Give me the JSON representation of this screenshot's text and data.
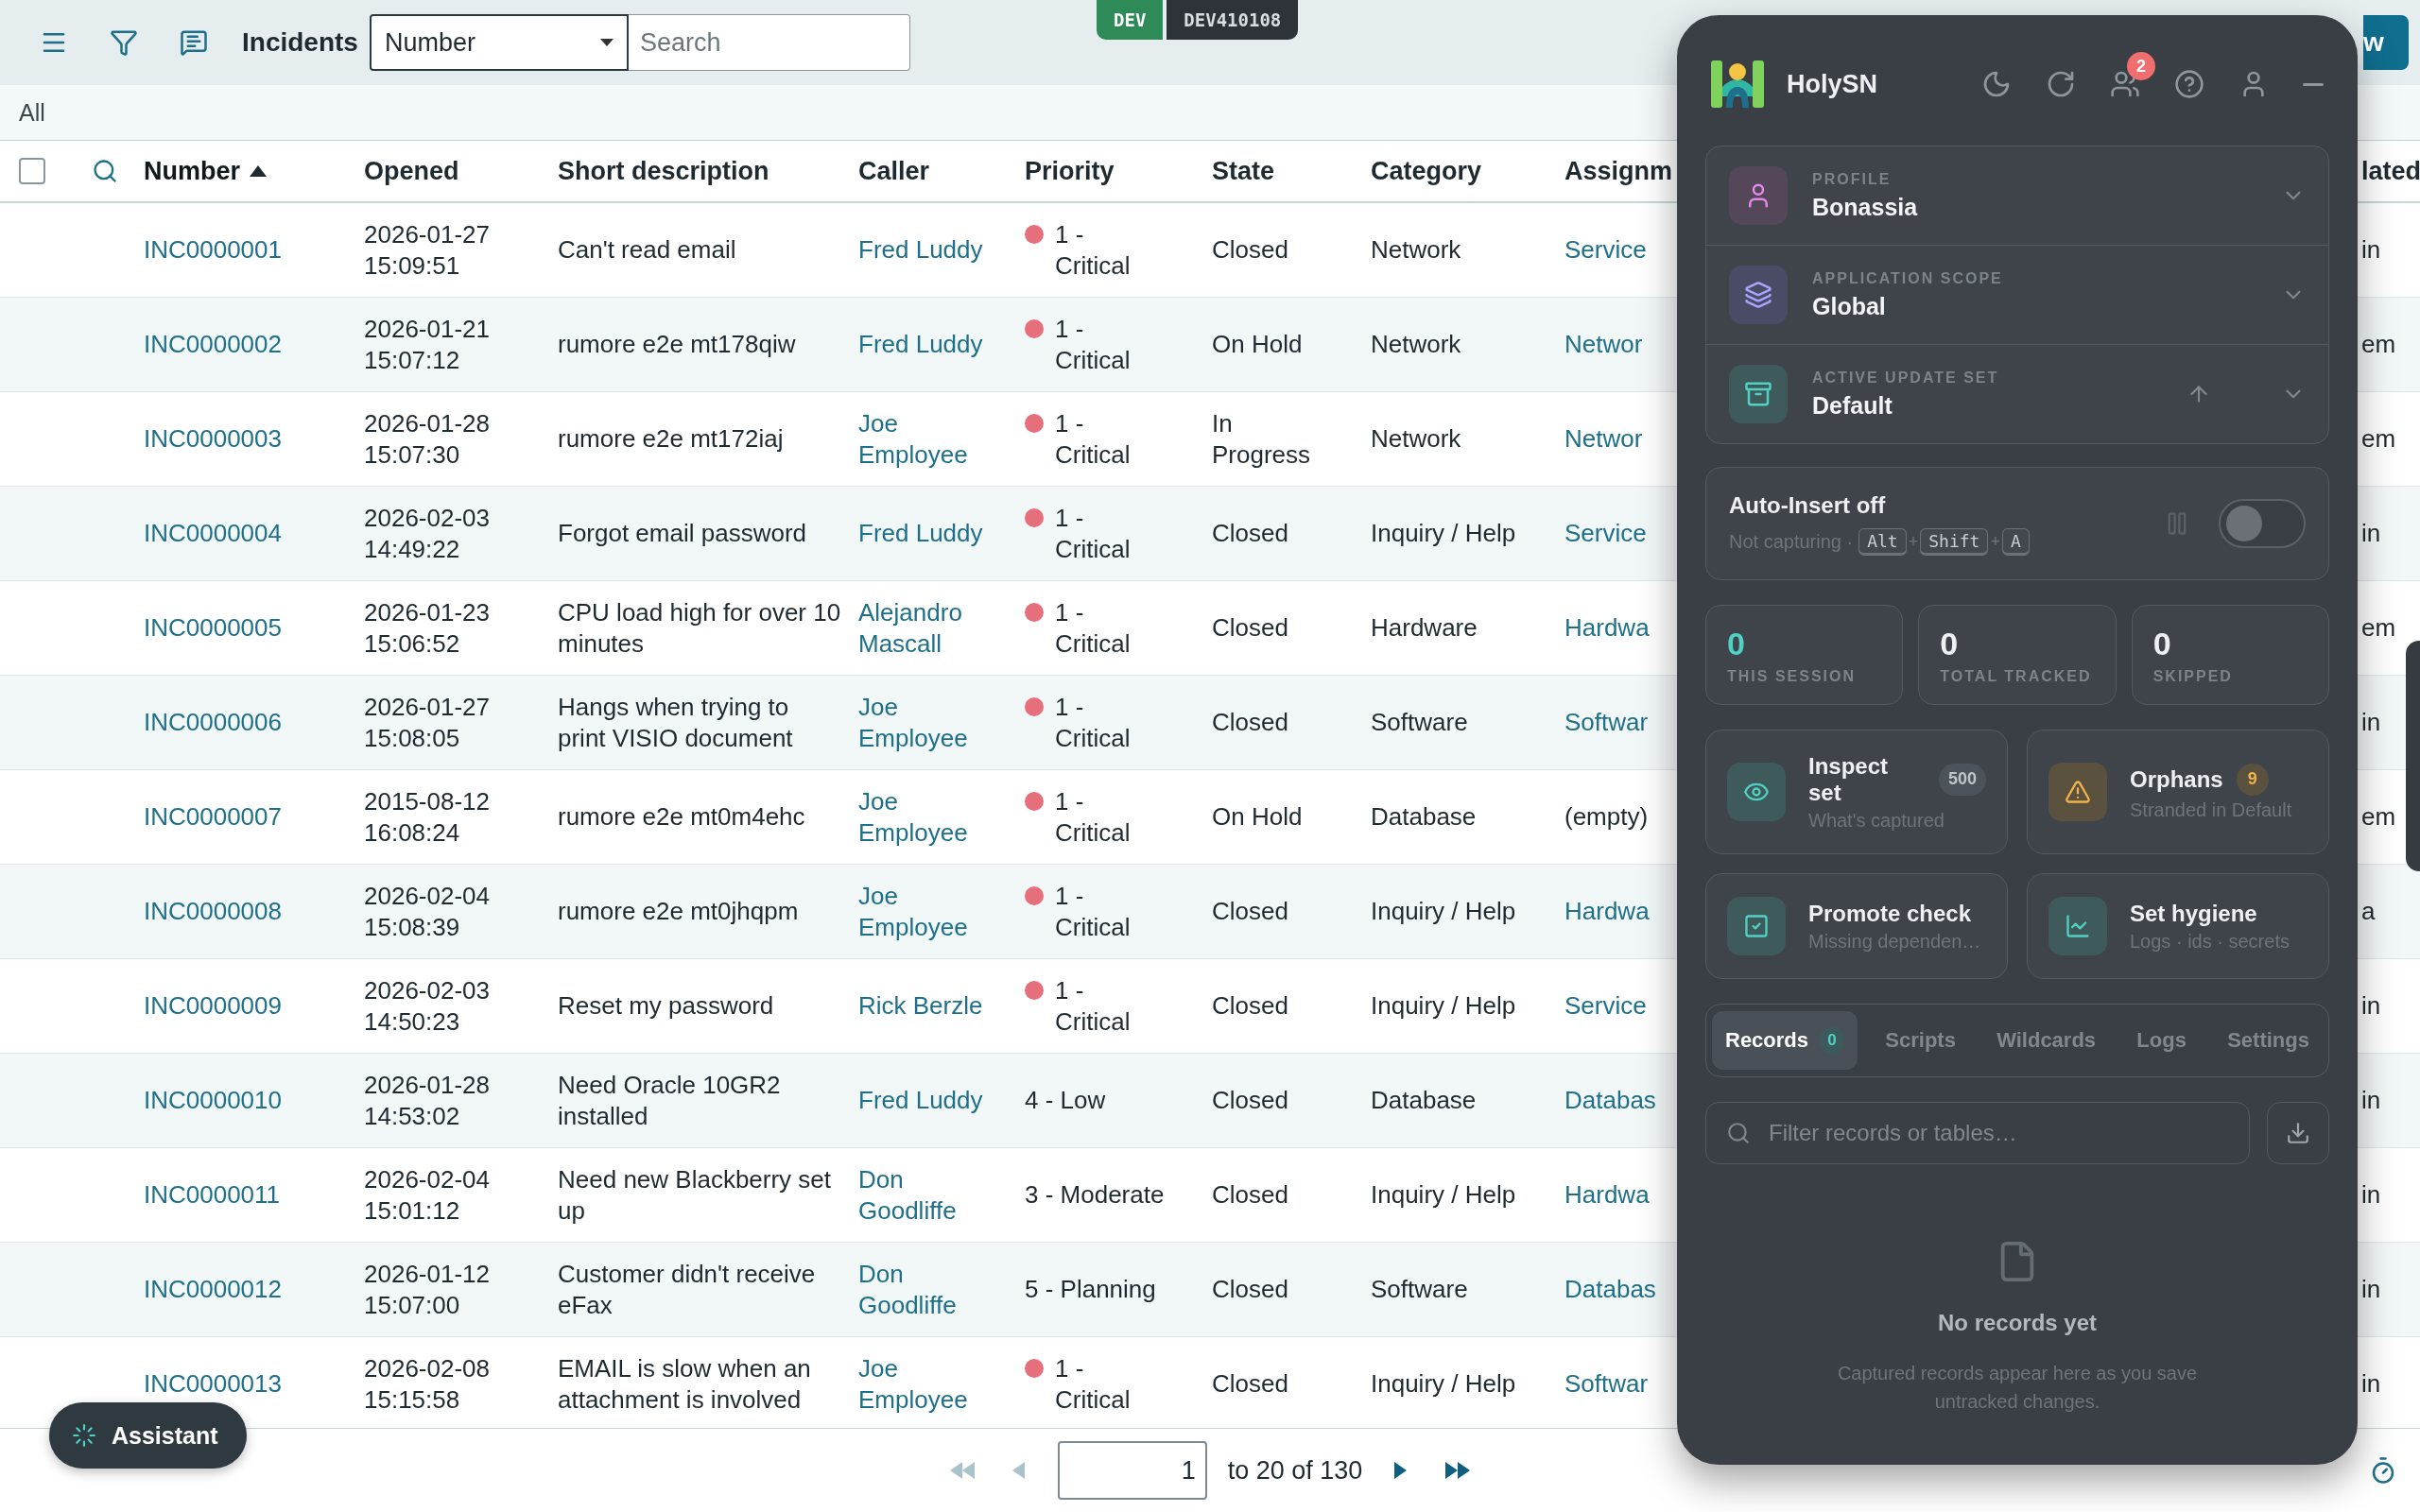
{
  "toolbar": {
    "title": "Incidents",
    "field_select": "Number",
    "search_placeholder": "Search",
    "new_button": "w"
  },
  "env_badge": {
    "env": "DEV",
    "instance": "DEV410108"
  },
  "breadcrumb": "All",
  "table": {
    "select_all": {
      "checked": false
    },
    "columns": [
      {
        "label": "Number",
        "sorted": true
      },
      {
        "label": "Opened",
        "sorted": false
      },
      {
        "label": "Short description",
        "sorted": false
      },
      {
        "label": "Caller",
        "sorted": false
      },
      {
        "label": "Priority",
        "sorted": false
      },
      {
        "label": "State",
        "sorted": false
      },
      {
        "label": "Category",
        "sorted": false
      },
      {
        "label": "Assignm",
        "sorted": false
      },
      {
        "label": "lated",
        "sorted": false
      }
    ],
    "rows": [
      {
        "number": "INC0000001",
        "opened": "2026-01-27 15:09:51",
        "description": "Can't read email",
        "caller": "Fred Luddy",
        "priority": {
          "text": "1 - Critical",
          "color": "#e5707c"
        },
        "state": "Closed",
        "category": "Network",
        "assignment": {
          "text": "Service",
          "link": true
        },
        "column_10": "in"
      },
      {
        "number": "INC0000002",
        "opened": "2026-01-21 15:07:12",
        "description": "rumore e2e mt178qiw",
        "caller": "Fred Luddy",
        "priority": {
          "text": "1 - Critical",
          "color": "#e5707c"
        },
        "state": "On Hold",
        "category": "Network",
        "assignment": {
          "text": "Networ",
          "link": true
        },
        "column_10": "em"
      },
      {
        "number": "INC0000003",
        "opened": "2026-01-28 15:07:30",
        "description": "rumore e2e mt172iaj",
        "caller": "Joe Employee",
        "priority": {
          "text": "1 - Critical",
          "color": "#e5707c"
        },
        "state": "In Progress",
        "category": "Network",
        "assignment": {
          "text": "Networ",
          "link": true
        },
        "column_10": "em"
      },
      {
        "number": "INC0000004",
        "opened": "2026-02-03 14:49:22",
        "description": "Forgot email password",
        "caller": "Fred Luddy",
        "priority": {
          "text": "1 - Critical",
          "color": "#e5707c"
        },
        "state": "Closed",
        "category": "Inquiry / Help",
        "assignment": {
          "text": "Service",
          "link": true
        },
        "column_10": "in"
      },
      {
        "number": "INC0000005",
        "opened": "2026-01-23 15:06:52",
        "description": "CPU load high for over 10 minutes",
        "caller": "Alejandro Mascall",
        "priority": {
          "text": "1 - Critical",
          "color": "#e5707c"
        },
        "state": "Closed",
        "category": "Hardware",
        "assignment": {
          "text": "Hardwa",
          "link": true
        },
        "column_10": "em"
      },
      {
        "number": "INC0000006",
        "opened": "2026-01-27 15:08:05",
        "description": "Hangs when trying to print VISIO document",
        "caller": "Joe Employee",
        "priority": {
          "text": "1 - Critical",
          "color": "#e5707c"
        },
        "state": "Closed",
        "category": "Software",
        "assignment": {
          "text": "Softwar",
          "link": true
        },
        "column_10": "in"
      },
      {
        "number": "INC0000007",
        "opened": "2015-08-12 16:08:24",
        "description": "rumore e2e mt0m4ehc",
        "caller": "Joe Employee",
        "priority": {
          "text": "1 - Critical",
          "color": "#e5707c"
        },
        "state": "On Hold",
        "category": "Database",
        "assignment": {
          "text": "(empty)",
          "link": false
        },
        "column_10": "em"
      },
      {
        "number": "INC0000008",
        "opened": "2026-02-04 15:08:39",
        "description": "rumore e2e mt0jhqpm",
        "caller": "Joe Employee",
        "priority": {
          "text": "1 - Critical",
          "color": "#e5707c"
        },
        "state": "Closed",
        "category": "Inquiry / Help",
        "assignment": {
          "text": "Hardwa",
          "link": true
        },
        "column_10": "a"
      },
      {
        "number": "INC0000009",
        "opened": "2026-02-03 14:50:23",
        "description": "Reset my password",
        "caller": "Rick Berzle",
        "priority": {
          "text": "1 - Critical",
          "color": "#e5707c"
        },
        "state": "Closed",
        "category": "Inquiry / Help",
        "assignment": {
          "text": "Service",
          "link": true
        },
        "column_10": "in"
      },
      {
        "number": "INC0000010",
        "opened": "2026-01-28 14:53:02",
        "description": "Need Oracle 10GR2 installed",
        "caller": "Fred Luddy",
        "priority": {
          "text": "4 - Low"
        },
        "state": "Closed",
        "category": "Database",
        "assignment": {
          "text": "Databas",
          "link": true
        },
        "column_10": "in"
      },
      {
        "number": "INC0000011",
        "opened": "2026-02-04 15:01:12",
        "description": "Need new Blackberry set up",
        "caller": "Don Goodliffe",
        "priority": {
          "text": "3 - Moderate"
        },
        "state": "Closed",
        "category": "Inquiry / Help",
        "assignment": {
          "text": "Hardwa",
          "link": true
        },
        "column_10": "in"
      },
      {
        "number": "INC0000012",
        "opened": "2026-01-12 15:07:00",
        "description": "Customer didn't receive eFax",
        "caller": "Don Goodliffe",
        "priority": {
          "text": "5 - Planning"
        },
        "state": "Closed",
        "category": "Software",
        "assignment": {
          "text": "Databas",
          "link": true
        },
        "column_10": "in"
      },
      {
        "number": "INC0000013",
        "opened": "2026-02-08 15:15:58",
        "description": "EMAIL is slow when an attachment is involved",
        "caller": "Joe Employee",
        "priority": {
          "text": "1 - Critical",
          "color": "#e5707c"
        },
        "state": "Closed",
        "category": "Inquiry / Help",
        "assignment": {
          "text": "Softwar",
          "link": true
        },
        "column_10": "in"
      }
    ]
  },
  "pagination": {
    "first_disabled": true,
    "prev_disabled": true,
    "page": "1",
    "range": "to 20 of 130",
    "next_disabled": false,
    "last_disabled": false
  },
  "assistant": "Assistant",
  "panel": {
    "title": "HolySN",
    "notifications": "2",
    "context": [
      {
        "kind": "profile",
        "label": "PROFILE",
        "value": "Bonassia"
      },
      {
        "kind": "scope",
        "label": "APPLICATION SCOPE",
        "value": "Global"
      },
      {
        "kind": "update_set",
        "label": "ACTIVE UPDATE SET",
        "value": "Default"
      }
    ],
    "auto_insert": {
      "title": "Auto-Insert off",
      "status": "Not capturing ·",
      "keys": [
        "Alt",
        "Shift",
        "A"
      ],
      "separator": "+",
      "on": false
    },
    "stats": [
      {
        "value": "0",
        "label": "THIS SESSION",
        "color": "#4fd1c5"
      },
      {
        "value": "0",
        "label": "TOTAL TRACKED",
        "color": "#eef1f4"
      },
      {
        "value": "0",
        "label": "SKIPPED",
        "color": "#eef1f4"
      }
    ],
    "actions": [
      {
        "kind": "inspect",
        "title": "Inspect set",
        "subtitle": "What's captured",
        "badge": "500"
      },
      {
        "kind": "orphans",
        "title": "Orphans",
        "subtitle": "Stranded in Default",
        "badge": "9"
      },
      {
        "kind": "promote",
        "title": "Promote check",
        "subtitle": "Missing dependen…"
      },
      {
        "kind": "hygiene",
        "title": "Set hygiene",
        "subtitle": "Logs · ids · secrets"
      }
    ],
    "tabs": [
      {
        "label": "Records",
        "selected": true,
        "count": "0"
      },
      {
        "label": "Scripts",
        "selected": false
      },
      {
        "label": "Wildcards",
        "selected": false
      },
      {
        "label": "Logs",
        "selected": false
      },
      {
        "label": "Settings",
        "selected": false
      }
    ],
    "filter_placeholder": "Filter records or tables…",
    "empty": {
      "title": "No records yet",
      "text": "Captured records appear here as you save untracked changes."
    }
  }
}
